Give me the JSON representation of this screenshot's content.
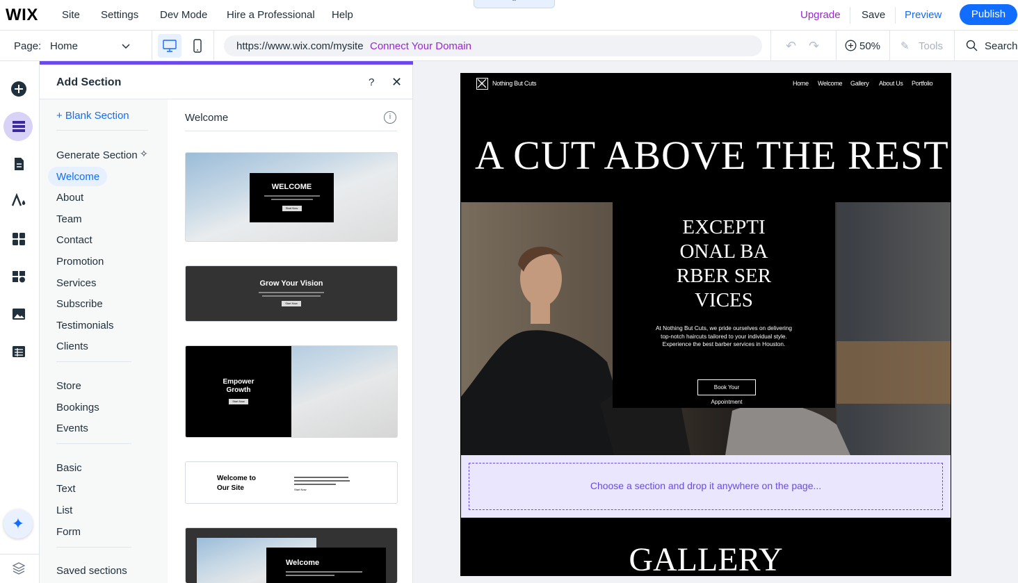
{
  "topbar": {
    "logo": "WIX",
    "menu": [
      "Site",
      "Settings",
      "Dev Mode",
      "Hire a Professional",
      "Help"
    ],
    "handle": "⌃",
    "upgrade": "Upgrade",
    "save": "Save",
    "preview": "Preview",
    "publish": "Publish"
  },
  "toolbar": {
    "page_label": "Page:",
    "page_value": "Home",
    "url": "https://www.wix.com/mysite",
    "connect_domain": "Connect Your Domain",
    "zoom": "50%",
    "tools": "Tools",
    "search": "Search"
  },
  "rail_icons": [
    "add-icon",
    "sections-icon",
    "pages-icon",
    "design-icon",
    "apps-icon",
    "business-icon",
    "media-icon",
    "cms-icon",
    "ai-assistant-icon",
    "layers-icon"
  ],
  "panel": {
    "title": "Add Section",
    "help": "?",
    "close": "✕",
    "blank_section": "+ Blank Section",
    "categories_group1": [
      "Generate Section",
      "Welcome",
      "About",
      "Team",
      "Contact",
      "Promotion",
      "Services",
      "Subscribe",
      "Testimonials",
      "Clients"
    ],
    "categories_group2": [
      "Store",
      "Bookings",
      "Events"
    ],
    "categories_group3": [
      "Basic",
      "Text",
      "List",
      "Form"
    ],
    "saved_sections": "Saved sections",
    "selected_category": "Welcome",
    "section_heading": "Welcome",
    "thumbnails": [
      {
        "title": "WELCOME",
        "button": "Start Now"
      },
      {
        "title": "Grow Your Vision",
        "button": "Start Now"
      },
      {
        "title": "Empower Growth",
        "button": "Start Now"
      },
      {
        "title": "Welcome to Our Site",
        "button": "Start Now"
      },
      {
        "title": "Welcome"
      }
    ]
  },
  "site": {
    "logo_text": "Nothing But Cuts",
    "nav": [
      "Home",
      "Welcome",
      "Gallery",
      "About Us",
      "Portfolio"
    ],
    "hero": "A CUT ABOVE THE REST",
    "headline": "EXCEPTIONAL BARBER SERVICES",
    "body": "At Nothing But Cuts, we pride ourselves on delivering top-notch haircuts tailored to your individual style. Experience the best barber services in Houston.",
    "button": "Book Your Appointment",
    "dropzone": "Choose a section and drop it anywhere on the page...",
    "gallery": "GALLERY"
  },
  "colors": {
    "accent_blue": "#116dff",
    "accent_purple": "#6c48ef",
    "upgrade_purple": "#9a27d5"
  }
}
